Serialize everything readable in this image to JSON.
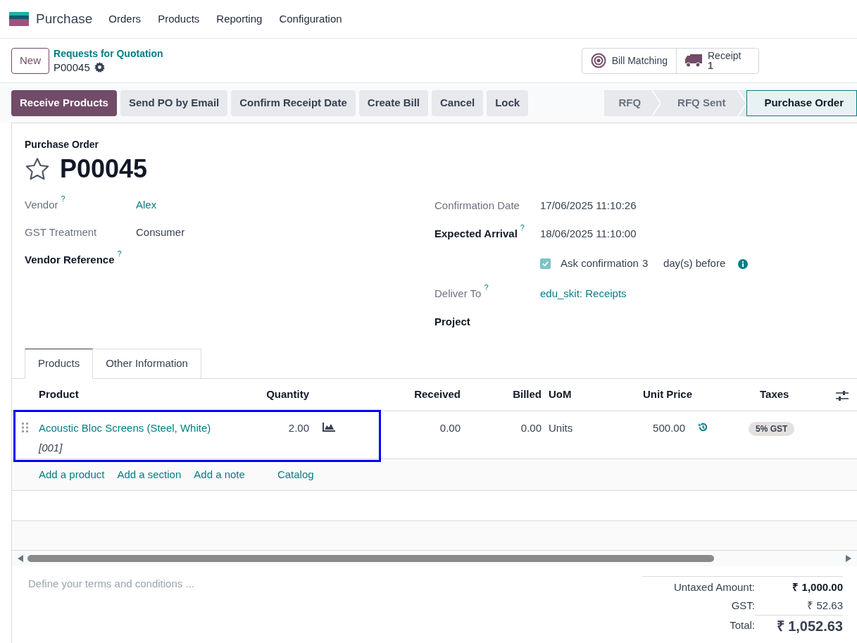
{
  "app": {
    "name": "Purchase",
    "menu": [
      "Orders",
      "Products",
      "Reporting",
      "Configuration"
    ]
  },
  "control_panel": {
    "new_button": "New",
    "breadcrumb": "Requests for Quotation",
    "record": "P00045",
    "smart_buttons": [
      {
        "kind": "target",
        "label": "Bill Matching"
      },
      {
        "kind": "truck",
        "label": "Receipt",
        "value": "1"
      }
    ]
  },
  "actions": [
    {
      "label": "Receive Products",
      "primary": true
    },
    {
      "label": "Send PO by Email",
      "primary": false
    },
    {
      "label": "Confirm Receipt Date",
      "primary": false
    },
    {
      "label": "Create Bill",
      "primary": false
    },
    {
      "label": "Cancel",
      "primary": false
    },
    {
      "label": "Lock",
      "primary": false
    }
  ],
  "statusbar": [
    {
      "label": "RFQ",
      "selected": false
    },
    {
      "label": "RFQ Sent",
      "selected": false
    },
    {
      "label": "Purchase Order",
      "selected": true
    }
  ],
  "form": {
    "subtitle": "Purchase Order",
    "title": "P00045",
    "starred": false,
    "left_fields": [
      {
        "label": "Vendor",
        "help": "?",
        "required": false,
        "value": "Alex",
        "link": true
      },
      {
        "label": "GST Treatment",
        "required": false,
        "value": "Consumer",
        "link": false
      },
      {
        "label": "Vendor Reference",
        "help": "?",
        "required": true,
        "link": false
      }
    ],
    "right_fields": [
      {
        "kind": "field",
        "label": "Confirmation Date",
        "required": false,
        "value": "17/06/2025 11:10:26",
        "link": false
      },
      {
        "kind": "field",
        "label": "Expected Arrival",
        "help": "?",
        "required": true,
        "value": "18/06/2025 11:10:00",
        "link": false
      },
      {
        "kind": "checkbox",
        "checked": true,
        "label": "Ask confirmation",
        "days": "3",
        "suffix": "day(s) before"
      },
      {
        "kind": "field",
        "label": "Deliver To",
        "help": "?",
        "required": false,
        "value": "edu_skit: Receipts",
        "link": true
      },
      {
        "kind": "field",
        "label": "Project",
        "required": true,
        "link": false
      }
    ]
  },
  "tabs": [
    {
      "label": "Products",
      "selected": true
    },
    {
      "label": "Other Information",
      "selected": false
    }
  ],
  "table": {
    "columns": [
      "Product",
      "Quantity",
      "Received",
      "Billed",
      "UoM",
      "Unit Price",
      "Taxes"
    ],
    "rows": [
      {
        "product": "Acoustic Bloc Screens (Steel, White)",
        "code": "[001]",
        "quantity": "2.00",
        "received": "0.00",
        "billed": "0.00",
        "uom": "Units",
        "unit_price": "500.00",
        "taxes": "5% GST"
      }
    ],
    "add_links": [
      "Add a product",
      "Add a section",
      "Add a note",
      "Catalog"
    ]
  },
  "terms_placeholder": "Define your terms and conditions ...",
  "totals": [
    {
      "label": "Untaxed Amount:",
      "value": "₹ 1,000.00",
      "kind": "bold"
    },
    {
      "label": "GST:",
      "value": "₹ 52.63",
      "kind": "plain"
    },
    {
      "label": "Total:",
      "value": "₹ 1,052.63",
      "kind": "total"
    }
  ]
}
